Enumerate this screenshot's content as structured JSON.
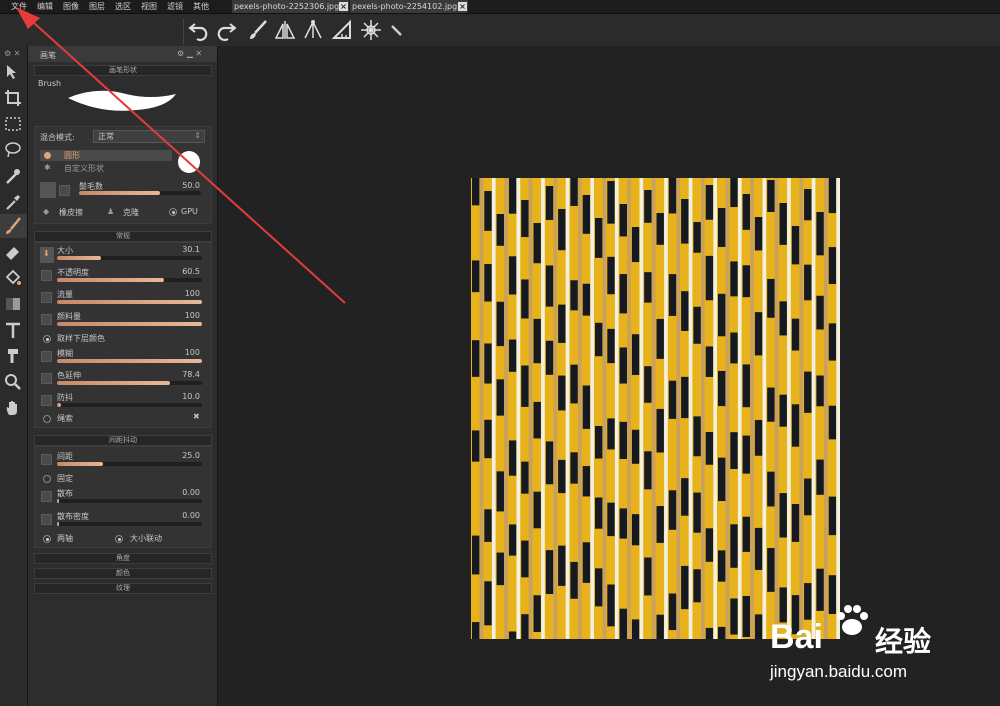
{
  "menu": [
    "文件",
    "编辑",
    "图像",
    "图层",
    "选区",
    "视图",
    "滤镜",
    "其他"
  ],
  "doc_tabs": [
    "pexels-photo-2252306.jpg",
    "pexels-photo-2254102.jpg"
  ],
  "panel": {
    "title": "画笔",
    "section_brush_shape": "画笔形状",
    "brush_label": "Brush",
    "blend_mode_label": "混合模式:",
    "blend_mode_value": "正常",
    "shape_circle": "圆形",
    "shape_custom": "自定义形状",
    "bristles_label": "鬃毛数",
    "bristles_value": "50.0",
    "bristles_pct": 0.66,
    "eraser_label": "橡皮擦",
    "clone_label": "克隆",
    "gpu_label": "GPU",
    "section_general": "常规",
    "size_label": "大小",
    "size_value": "30.1",
    "size_pct": 0.3,
    "opacity_label": "不透明度",
    "opacity_value": "60.5",
    "opacity_pct": 0.74,
    "flow_label": "流量",
    "flow_value": "100",
    "flow_pct": 1.0,
    "paint_label": "颜料量",
    "paint_value": "100",
    "paint_pct": 1.0,
    "sample_label": "取样下层颜色",
    "blur_label": "模糊",
    "blur_value": "100",
    "blur_pct": 1.0,
    "stretch_label": "色延伸",
    "stretch_value": "78.4",
    "stretch_pct": 0.78,
    "jitter_label": "防抖",
    "jitter_value": "10.0",
    "jitter_pct": 0.03,
    "lasso_label": "绳索",
    "section_spacing": "间距抖动",
    "spacing_label": "间距",
    "spacing_value": "25.0",
    "spacing_pct": 0.32,
    "fixed_label": "固定",
    "scatter_label": "散布",
    "scatter_value": "0.00",
    "scatter_density_label": "散布密度",
    "scatter_density_value": "0.00",
    "both_axes_label": "两轴",
    "size_link_label": "大小联动",
    "section_angle": "角度",
    "section_color": "颜色",
    "section_texture": "纹理"
  },
  "watermark": {
    "brand": "Bai",
    "brand_cn": "经验",
    "url": "jingyan.baidu.com"
  },
  "colors": {
    "accent": "#e8a07a",
    "photo_yellow": "#e8b21a",
    "arrow": "#e53b3b"
  }
}
